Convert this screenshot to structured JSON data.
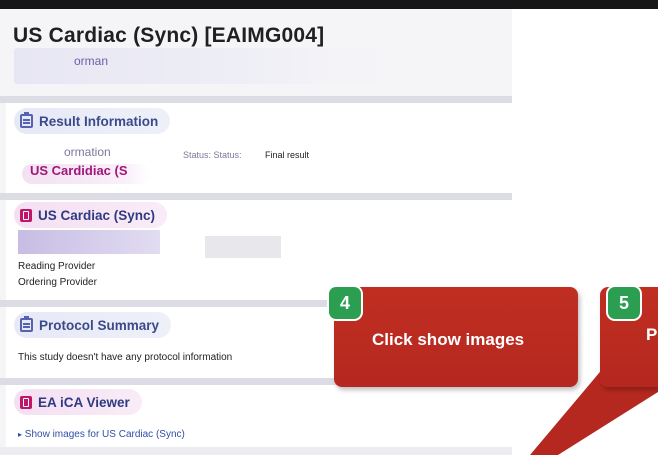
{
  "page": {
    "title": "US Cardiac (Sync) [EAIMG004]",
    "subheader_text": "orman"
  },
  "result_information": {
    "heading": "Result Information",
    "faded_label": "ormation",
    "study_name": "US Cardidiac (S",
    "status_text": "Status: Status:",
    "status_value": "Final result"
  },
  "us_cardiac": {
    "heading": "US Cardiac (Sync)",
    "reading_provider_label": "Reading Provider",
    "ordering_provider_label": "Ordering Provider"
  },
  "protocol_summary": {
    "heading": "Protocol Summary",
    "body": "This study doesn't have any protocol information"
  },
  "ea_ica_viewer": {
    "heading": "EA iCA Viewer",
    "link_text": "Show images for US Cardiac (Sync)"
  },
  "callouts": [
    {
      "number": "4",
      "text": "Click show images"
    },
    {
      "number": "5",
      "text": "P"
    }
  ],
  "colors": {
    "callout_red": "#b5281f",
    "badge_green": "#2c9e52",
    "heading_blue": "#3b4a8a",
    "accent_magenta": "#c0166a"
  }
}
